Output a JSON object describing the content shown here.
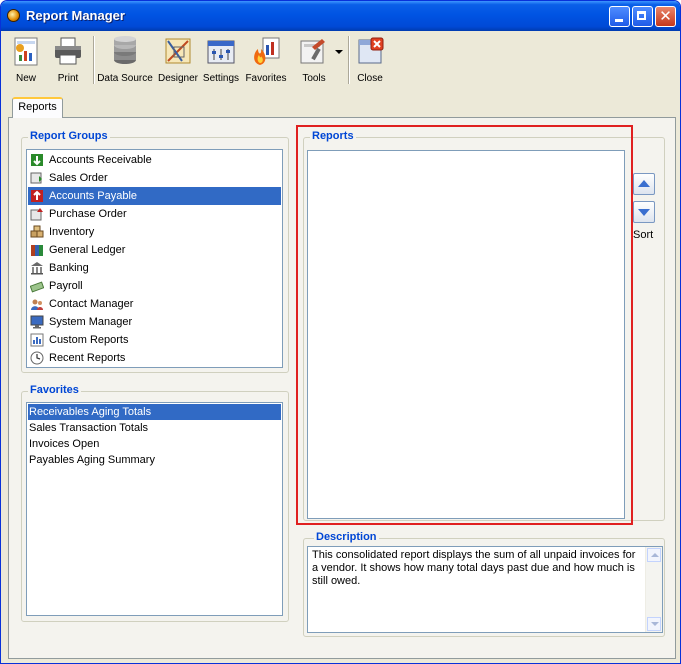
{
  "window": {
    "title": "Report Manager"
  },
  "toolbar": {
    "new": "New",
    "print": "Print",
    "data_source": "Data Source",
    "designer": "Designer",
    "settings": "Settings",
    "favorites": "Favorites",
    "tools": "Tools",
    "close": "Close"
  },
  "tabs": {
    "reports": "Reports"
  },
  "report_groups": {
    "title": "Report Groups",
    "selected": "Accounts Payable",
    "items": [
      {
        "label": "Accounts Receivable",
        "icon": "accounts-receivable-icon"
      },
      {
        "label": "Sales Order",
        "icon": "sales-order-icon"
      },
      {
        "label": "Accounts Payable",
        "icon": "accounts-payable-icon"
      },
      {
        "label": "Purchase Order",
        "icon": "purchase-order-icon"
      },
      {
        "label": "Inventory",
        "icon": "inventory-icon"
      },
      {
        "label": "General Ledger",
        "icon": "general-ledger-icon"
      },
      {
        "label": "Banking",
        "icon": "bank-icon"
      },
      {
        "label": "Payroll",
        "icon": "payroll-icon"
      },
      {
        "label": "Contact Manager",
        "icon": "contacts-icon"
      },
      {
        "label": "System Manager",
        "icon": "monitor-icon"
      },
      {
        "label": "Custom Reports",
        "icon": "custom-report-icon"
      },
      {
        "label": "Recent Reports",
        "icon": "clock-icon"
      }
    ]
  },
  "favorites": {
    "title": "Favorites",
    "selected": "Receivables Aging Totals",
    "items": [
      "Receivables Aging Totals",
      "Sales Transaction Totals",
      "Invoices Open",
      "Payables Aging Summary"
    ]
  },
  "reports": {
    "title": "Reports",
    "items": []
  },
  "sort": {
    "label": "Sort"
  },
  "description": {
    "title": "Description",
    "text": "This consolidated report displays the sum of all unpaid invoices for a vendor.  It shows how many total days past due and how much is still owed."
  },
  "colors": {
    "selection": "#316ac5",
    "group_title": "#0046d5",
    "highlight_box": "#e02020"
  }
}
